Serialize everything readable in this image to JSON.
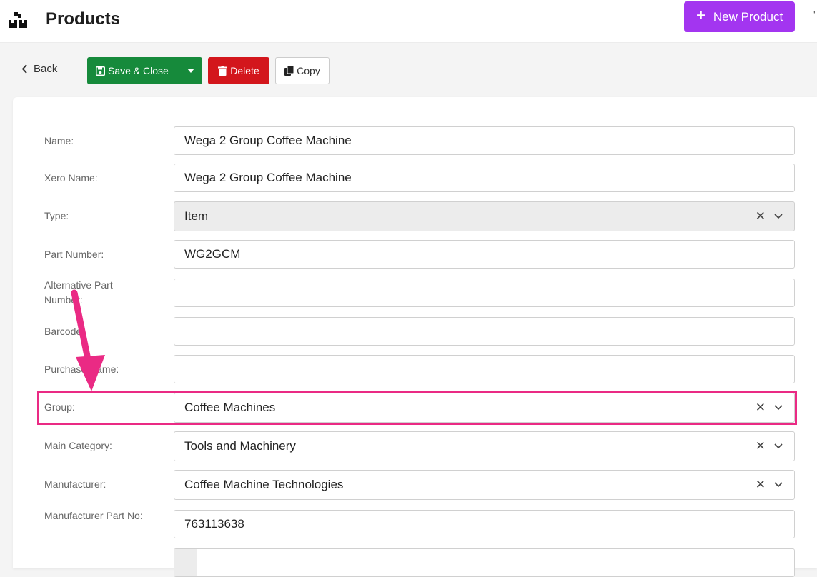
{
  "header": {
    "title": "Products",
    "new_button_label": "New Product",
    "app_icon": "boxes-icon"
  },
  "toolbar": {
    "back_label": "Back",
    "save_label": "Save & Close",
    "delete_label": "Delete",
    "copy_label": "Copy"
  },
  "form": {
    "name": {
      "label": "Name:",
      "value": "Wega 2 Group Coffee Machine"
    },
    "xero_name": {
      "label": "Xero Name:",
      "value": "Wega 2 Group Coffee Machine"
    },
    "type": {
      "label": "Type:",
      "value": "Item"
    },
    "part_number": {
      "label": "Part Number:",
      "value": "WG2GCM"
    },
    "alt_part_number": {
      "label": "Alternative Part Number:",
      "value": ""
    },
    "barcode": {
      "label": "Barcode:",
      "value": ""
    },
    "purchase_name": {
      "label": "Purchase Name:",
      "value": ""
    },
    "group": {
      "label": "Group:",
      "value": "Coffee Machines"
    },
    "main_category": {
      "label": "Main Category:",
      "value": "Tools and Machinery"
    },
    "manufacturer": {
      "label": "Manufacturer:",
      "value": "Coffee Machine Technologies"
    },
    "manufacturer_part_no": {
      "label": "Manufacturer Part No:",
      "value": "763113638"
    }
  },
  "colors": {
    "new_button": "#a335f0",
    "save_button": "#168a3b",
    "delete_button": "#d3161c",
    "annotation": "#ea2a84"
  }
}
